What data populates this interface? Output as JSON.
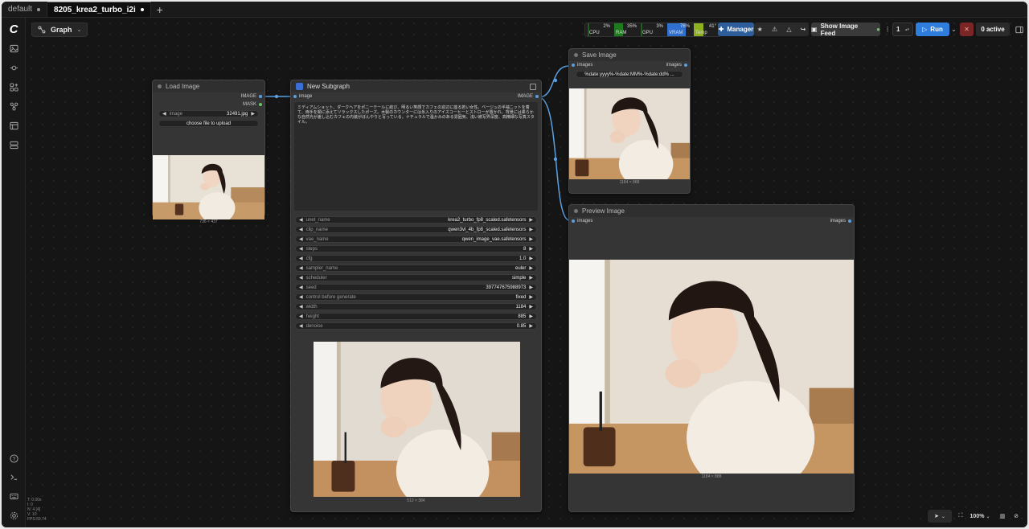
{
  "tabs": [
    {
      "label": "default",
      "active": false
    },
    {
      "label": "8205_krea2_turbo_i2i",
      "active": true
    }
  ],
  "add_tab_label": "+",
  "canvas": {
    "graph_label": "Graph"
  },
  "toolbar": {
    "meters": [
      {
        "label": "CPU",
        "value": "2%",
        "color": "#1e7a1e",
        "fill": 0.02
      },
      {
        "label": "RAM",
        "value": "35%",
        "color": "#1e7a1e",
        "fill": 0.35
      },
      {
        "label": "GPU",
        "value": "3%",
        "color": "#1e7a1e",
        "fill": 0.03
      },
      {
        "label": "VRAM",
        "value": "76%",
        "color": "#2f6fcf",
        "fill": 0.76
      },
      {
        "label": "Temp",
        "value": "41°",
        "color": "#8cb01e",
        "fill": 0.41
      }
    ],
    "manager_label": "Manager",
    "show_image_feed_label": "Show Image Feed",
    "queue_count": "1",
    "run_label": "Run",
    "active_label": "0 active"
  },
  "nodes": {
    "load_image": {
      "title": "Load Image",
      "outputs": [
        "IMAGE",
        "MASK"
      ],
      "image_widget": {
        "name": "image",
        "value": "32491.jpg"
      },
      "upload_label": "choose file to upload",
      "caption": "736 × 437"
    },
    "subgraph": {
      "title": "New Subgraph",
      "input": "image",
      "output": "IMAGE",
      "prompt_text": "ミディアムショット、ダークヘアをポニーテールに結び、明るい笑顔でカフェの窓辺に座る若い女性。ベージュの半袖ニットを着て、両手を頬に添えてリラックスしたポーズ。木製のカウンターには氷入りのアイスコーヒーとストローが置かれ、背景には柔らかな自然光が差し込むカフェの内装がぼんやりと写っている。ナチュラルで温かみのある雰囲気、浅い被写界深度、高精細な写真スタイル。",
      "widgets": [
        {
          "name": "unet_name",
          "value": "krea2_turbo_fp8_scaled.safetensors"
        },
        {
          "name": "clip_name",
          "value": "qwen3vl_4b_fp8_scaled.safetensors"
        },
        {
          "name": "vae_name",
          "value": "qwen_image_vae.safetensors"
        },
        {
          "name": "steps",
          "value": "8"
        },
        {
          "name": "cfg",
          "value": "1.0"
        },
        {
          "name": "sampler_name",
          "value": "euler"
        },
        {
          "name": "scheduler",
          "value": "simple"
        },
        {
          "name": "seed",
          "value": "397747675988973"
        },
        {
          "name": "control before generate",
          "value": "fixed"
        },
        {
          "name": "width",
          "value": "1184"
        },
        {
          "name": "height",
          "value": "885"
        },
        {
          "name": "denoise",
          "value": "0.85"
        }
      ],
      "caption": "512 × 384"
    },
    "save_image": {
      "title": "Save Image",
      "input": "images",
      "output": "images",
      "filename": "%date:yyyy%-%date:MM%-%date:dd% ...",
      "caption": "1184 × 888"
    },
    "preview_image": {
      "title": "Preview Image",
      "input": "images",
      "output": "images",
      "caption": "1184 × 888"
    }
  },
  "stats": [
    "T: 0.00s",
    "I: 0",
    "N: 4 [4]",
    "V: 10",
    "FPS:59.74"
  ],
  "zoom": "100%"
}
